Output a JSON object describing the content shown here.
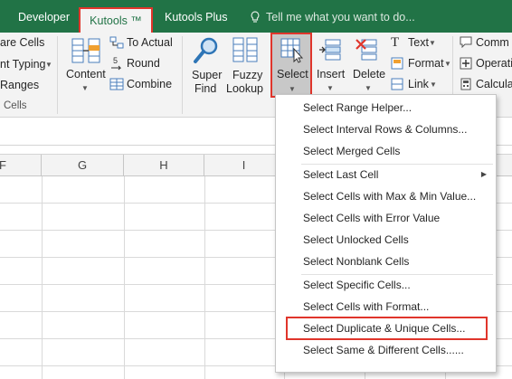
{
  "tabs": {
    "developer": "Developer",
    "kutools": "Kutools ™",
    "kutools_plus": "Kutools Plus",
    "tell_me": "Tell me what you want to do..."
  },
  "ribbon": {
    "left_partial": {
      "compare_cells": "are Cells",
      "prevent_typing": "nt Typing",
      "ranges": "Ranges",
      "group_cells": "Cells"
    },
    "content_label": "Content",
    "to_actual": "To Actual",
    "round": "Round",
    "combine": "Combine",
    "super_find": [
      "Super",
      "Find"
    ],
    "fuzzy_lookup": [
      "Fuzzy",
      "Lookup"
    ],
    "select": "Select",
    "insert": "Insert",
    "delete": "Delete",
    "text": "Text",
    "format": "Format",
    "link": "Link",
    "comment_partial": "Comm",
    "operation_partial": "Operati",
    "calculator_partial": "Calcula"
  },
  "columns": [
    "F",
    "G",
    "H",
    "I"
  ],
  "select_menu": {
    "items": [
      "Select Range Helper...",
      "Select Interval Rows & Columns...",
      "Select Merged Cells",
      "Select Last Cell",
      "Select Cells with Max & Min Value...",
      "Select Cells with Error Value",
      "Select Unlocked Cells",
      "Select Nonblank Cells",
      "Select Specific Cells...",
      "Select Cells with Format...",
      "Select Duplicate & Unique Cells...",
      "Select Same & Different Cells......"
    ],
    "highlighted_index": 10,
    "submenu_index": 3
  },
  "colors": {
    "ribbon_green": "#217346",
    "highlight_red": "#e0352b"
  }
}
